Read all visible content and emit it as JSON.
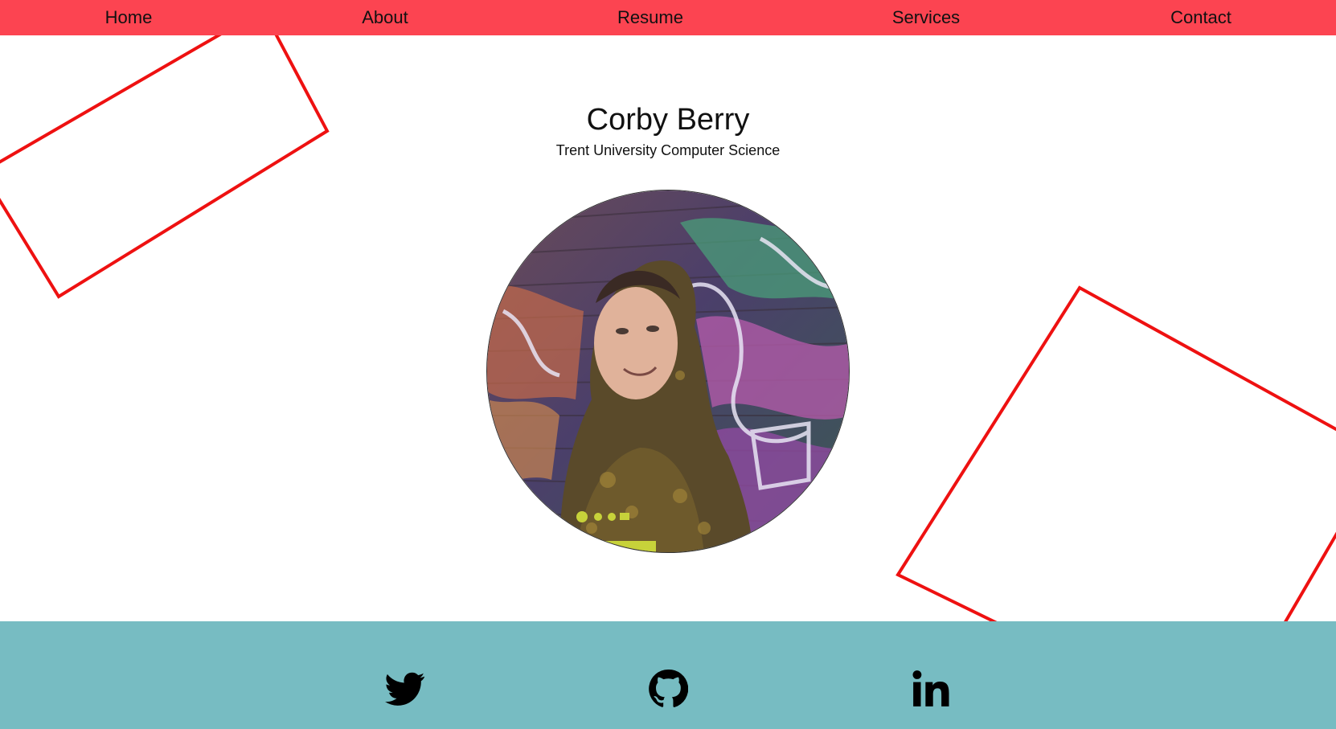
{
  "nav": {
    "items": [
      {
        "label": "Home"
      },
      {
        "label": "About"
      },
      {
        "label": "Resume"
      },
      {
        "label": "Services"
      },
      {
        "label": "Contact"
      }
    ]
  },
  "hero": {
    "name": "Corby Berry",
    "subtitle": "Trent University Computer Science",
    "photo_icon": "profile-photo"
  },
  "footer": {
    "social": [
      {
        "icon": "twitter-icon"
      },
      {
        "icon": "github-icon"
      },
      {
        "icon": "linkedin-icon"
      }
    ]
  },
  "colors": {
    "nav_bg": "#fc4451",
    "footer_bg": "#77bcc2",
    "deco_stroke": "#ee1111",
    "text": "#111111"
  }
}
